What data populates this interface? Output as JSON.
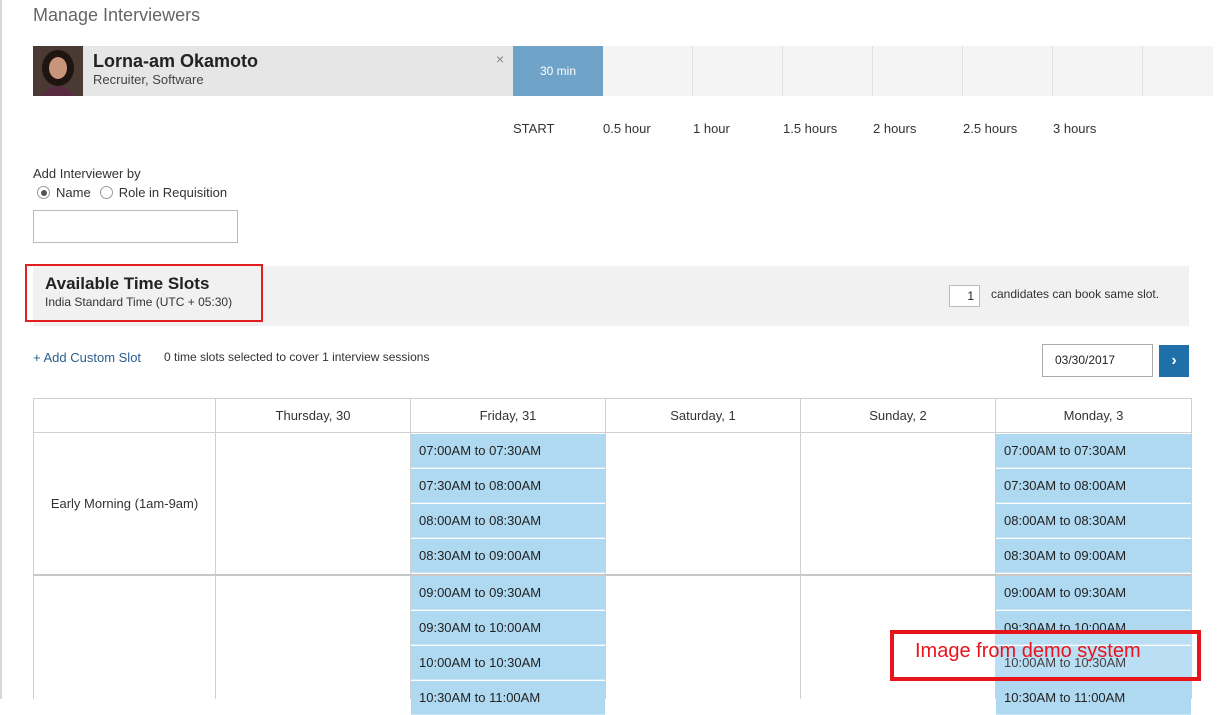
{
  "page_title": "Manage Interviewers",
  "interviewer": {
    "name": "Lorna-am Okamoto",
    "role": "Recruiter, Software",
    "close_label": "×",
    "duration_label": "30 min"
  },
  "timeline_ticks": [
    "START",
    "0.5 hour",
    "1 hour",
    "1.5 hours",
    "2 hours",
    "2.5 hours",
    "3 hours"
  ],
  "add_interviewer": {
    "label": "Add Interviewer by",
    "options": [
      {
        "label": "Name",
        "selected": true
      },
      {
        "label": "Role in Requisition",
        "selected": false
      }
    ],
    "search_value": ""
  },
  "time_slots": {
    "title": "Available Time Slots",
    "timezone": "India Standard Time (UTC + 05:30)",
    "candidates_count": "1",
    "candidates_label": "candidates can book same slot."
  },
  "toolbar": {
    "add_custom_slot": "+ Add Custom Slot",
    "summary": "0 time slots selected to cover 1 interview sessions",
    "date_value": "03/30/2017",
    "next_icon": "›"
  },
  "calendar": {
    "days": [
      "Thursday, 30",
      "Friday, 31",
      "Saturday, 1",
      "Sunday, 2",
      "Monday, 3"
    ],
    "row_labels": [
      "Early Morning (1am-9am)",
      ""
    ],
    "friday_slots": [
      "07:00AM to 07:30AM",
      "07:30AM to 08:00AM",
      "08:00AM to 08:30AM",
      "08:30AM to 09:00AM",
      "09:00AM to 09:30AM",
      "09:30AM to 10:00AM",
      "10:00AM to 10:30AM",
      "10:30AM to 11:00AM"
    ],
    "monday_slots": [
      "07:00AM to 07:30AM",
      "07:30AM to 08:00AM",
      "08:00AM to 08:30AM",
      "08:30AM to 09:00AM",
      "09:00AM to 09:30AM",
      "09:30AM to 10:00AM",
      "10:00AM to 10:30AM",
      "10:30AM to 11:00AM"
    ]
  },
  "overlay_note": "Image from demo system",
  "colors": {
    "accent": "#1f6fa8",
    "duration_block": "#6fa3c8",
    "slot_available": "#aed9f1",
    "highlight_red": "#e02020"
  },
  "icons": {
    "close": "close-icon",
    "next": "chevron-right-icon",
    "avatar": "avatar-photo"
  }
}
